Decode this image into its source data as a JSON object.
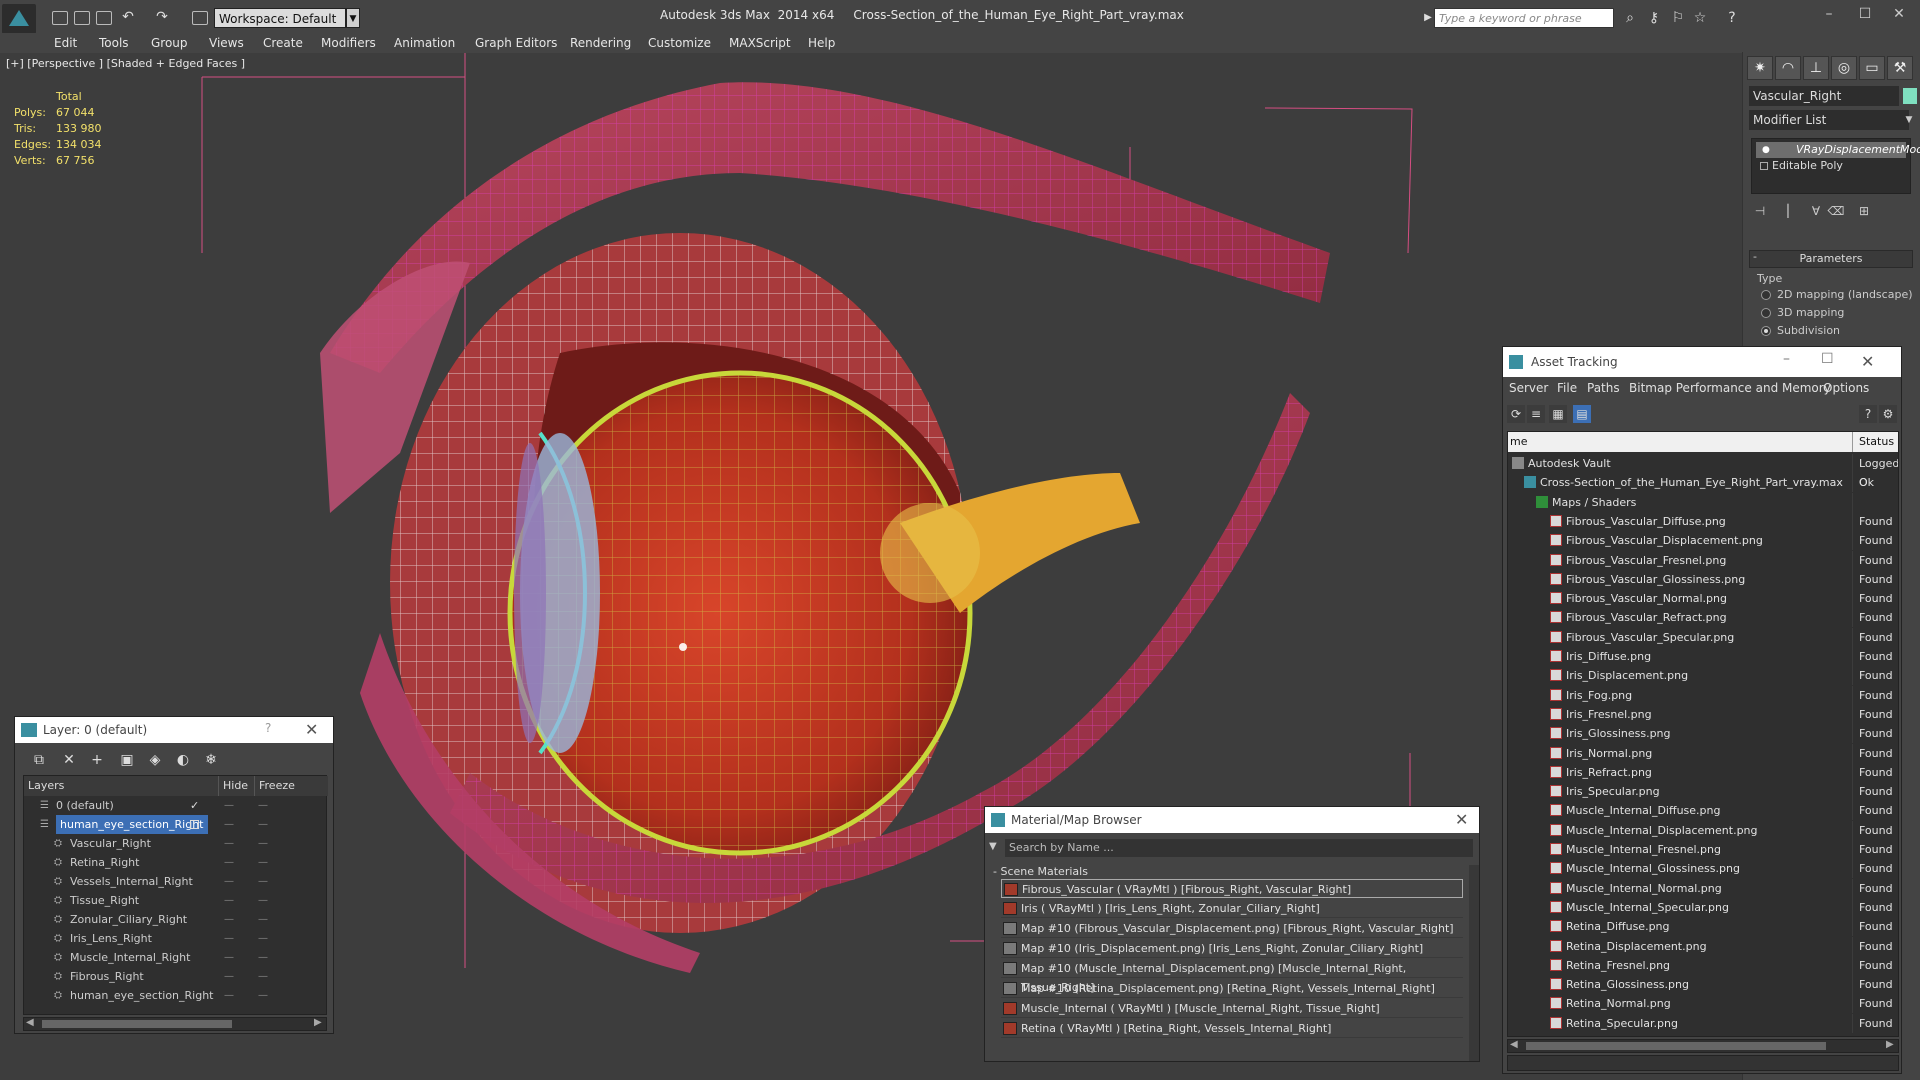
{
  "titlebar": {
    "app_title": "Autodesk 3ds Max  2014 x64     Cross-Section_of_the_Human_Eye_Right_Part_vray.max",
    "workspace": "Workspace: Default",
    "search_placeholder": "Type a keyword or phrase",
    "minimize": "–",
    "maximize": "☐",
    "close": "✕"
  },
  "menubar": [
    "Edit",
    "Tools",
    "Group",
    "Views",
    "Create",
    "Modifiers",
    "Animation",
    "Graph Editors",
    "Rendering",
    "Customize",
    "MAXScript",
    "Help"
  ],
  "viewport": {
    "label": "[+] [Perspective ] [Shaded + Edged Faces ]",
    "stats": {
      "header": "Total",
      "rows": [
        {
          "label": "Polys:",
          "value": "67 044"
        },
        {
          "label": "Tris:",
          "value": "133 980"
        },
        {
          "label": "Edges:",
          "value": "134 034"
        },
        {
          "label": "Verts:",
          "value": "67 756"
        }
      ]
    }
  },
  "command_panel": {
    "object_name": "Vascular_Right",
    "object_color": "#7fe0c0",
    "modifier_list": "Modifier List",
    "stack": [
      "VRayDisplacementMod",
      "Editable Poly"
    ],
    "parameters_header": "Parameters",
    "type_label": "Type",
    "type_options": [
      "2D mapping (landscape)",
      "3D mapping",
      "Subdivision"
    ],
    "selected_type": "Subdivision"
  },
  "layer_dialog": {
    "title": "Layer: 0 (default)",
    "help": "?",
    "columns": {
      "layers": "Layers",
      "hide": "Hide",
      "freeze": "Freeze"
    },
    "rows": [
      {
        "name": "0 (default)",
        "level": 0,
        "checked": true
      },
      {
        "name": "human_eye_section_Right",
        "level": 0,
        "selected": true
      },
      {
        "name": "Vascular_Right",
        "level": 1
      },
      {
        "name": "Retina_Right",
        "level": 1
      },
      {
        "name": "Vessels_Internal_Right",
        "level": 1
      },
      {
        "name": "Tissue_Right",
        "level": 1
      },
      {
        "name": "Zonular_Ciliary_Right",
        "level": 1
      },
      {
        "name": "Iris_Lens_Right",
        "level": 1
      },
      {
        "name": "Muscle_Internal_Right",
        "level": 1
      },
      {
        "name": "Fibrous_Right",
        "level": 1
      },
      {
        "name": "human_eye_section_Right",
        "level": 1
      }
    ]
  },
  "material_browser": {
    "title": "Material/Map Browser",
    "search_placeholder": "Search by Name ...",
    "group": "Scene Materials",
    "rows": [
      {
        "text": "Fibrous_Vascular  ( VRayMtl ) [Fibrous_Right, Vascular_Right]",
        "kind": "vray",
        "selected": true
      },
      {
        "text": "Iris  ( VRayMtl ) [Iris_Lens_Right, Zonular_Ciliary_Right]",
        "kind": "vray"
      },
      {
        "text": "Map #10 (Fibrous_Vascular_Displacement.png) [Fibrous_Right, Vascular_Right]",
        "kind": "map"
      },
      {
        "text": "Map #10 (Iris_Displacement.png) [Iris_Lens_Right, Zonular_Ciliary_Right]",
        "kind": "map"
      },
      {
        "text": "Map #10 (Muscle_Internal_Displacement.png) [Muscle_Internal_Right, Tissue_Right]",
        "kind": "map"
      },
      {
        "text": "Map #10 (Retina_Displacement.png) [Retina_Right, Vessels_Internal_Right]",
        "kind": "map"
      },
      {
        "text": "Muscle_Internal  ( VRayMtl ) [Muscle_Internal_Right, Tissue_Right]",
        "kind": "vray"
      },
      {
        "text": "Retina  ( VRayMtl ) [Retina_Right, Vessels_Internal_Right]",
        "kind": "vray"
      }
    ]
  },
  "asset_tracking": {
    "title": "Asset Tracking",
    "menu": [
      "Server",
      "File",
      "Paths",
      "Bitmap Performance and Memory",
      "Options"
    ],
    "columns": {
      "name": "me",
      "status": "Status"
    },
    "rows": [
      {
        "name": "Autodesk Vault",
        "status": "Logged O",
        "level": 0,
        "icon": "vault"
      },
      {
        "name": "Cross-Section_of_the_Human_Eye_Right_Part_vray.max",
        "status": "Ok",
        "level": 1,
        "icon": "max"
      },
      {
        "name": "Maps / Shaders",
        "status": "",
        "level": 2,
        "icon": "folder"
      },
      {
        "name": "Fibrous_Vascular_Diffuse.png",
        "status": "Found",
        "level": 3,
        "icon": "png"
      },
      {
        "name": "Fibrous_Vascular_Displacement.png",
        "status": "Found",
        "level": 3,
        "icon": "png"
      },
      {
        "name": "Fibrous_Vascular_Fresnel.png",
        "status": "Found",
        "level": 3,
        "icon": "png"
      },
      {
        "name": "Fibrous_Vascular_Glossiness.png",
        "status": "Found",
        "level": 3,
        "icon": "png"
      },
      {
        "name": "Fibrous_Vascular_Normal.png",
        "status": "Found",
        "level": 3,
        "icon": "png"
      },
      {
        "name": "Fibrous_Vascular_Refract.png",
        "status": "Found",
        "level": 3,
        "icon": "png"
      },
      {
        "name": "Fibrous_Vascular_Specular.png",
        "status": "Found",
        "level": 3,
        "icon": "png"
      },
      {
        "name": "Iris_Diffuse.png",
        "status": "Found",
        "level": 3,
        "icon": "png"
      },
      {
        "name": "Iris_Displacement.png",
        "status": "Found",
        "level": 3,
        "icon": "png"
      },
      {
        "name": "Iris_Fog.png",
        "status": "Found",
        "level": 3,
        "icon": "png"
      },
      {
        "name": "Iris_Fresnel.png",
        "status": "Found",
        "level": 3,
        "icon": "png"
      },
      {
        "name": "Iris_Glossiness.png",
        "status": "Found",
        "level": 3,
        "icon": "png"
      },
      {
        "name": "Iris_Normal.png",
        "status": "Found",
        "level": 3,
        "icon": "png"
      },
      {
        "name": "Iris_Refract.png",
        "status": "Found",
        "level": 3,
        "icon": "png"
      },
      {
        "name": "Iris_Specular.png",
        "status": "Found",
        "level": 3,
        "icon": "png"
      },
      {
        "name": "Muscle_Internal_Diffuse.png",
        "status": "Found",
        "level": 3,
        "icon": "png"
      },
      {
        "name": "Muscle_Internal_Displacement.png",
        "status": "Found",
        "level": 3,
        "icon": "png"
      },
      {
        "name": "Muscle_Internal_Fresnel.png",
        "status": "Found",
        "level": 3,
        "icon": "png"
      },
      {
        "name": "Muscle_Internal_Glossiness.png",
        "status": "Found",
        "level": 3,
        "icon": "png"
      },
      {
        "name": "Muscle_Internal_Normal.png",
        "status": "Found",
        "level": 3,
        "icon": "png"
      },
      {
        "name": "Muscle_Internal_Specular.png",
        "status": "Found",
        "level": 3,
        "icon": "png"
      },
      {
        "name": "Retina_Diffuse.png",
        "status": "Found",
        "level": 3,
        "icon": "png"
      },
      {
        "name": "Retina_Displacement.png",
        "status": "Found",
        "level": 3,
        "icon": "png"
      },
      {
        "name": "Retina_Fresnel.png",
        "status": "Found",
        "level": 3,
        "icon": "png"
      },
      {
        "name": "Retina_Glossiness.png",
        "status": "Found",
        "level": 3,
        "icon": "png"
      },
      {
        "name": "Retina_Normal.png",
        "status": "Found",
        "level": 3,
        "icon": "png"
      },
      {
        "name": "Retina_Specular.png",
        "status": "Found",
        "level": 3,
        "icon": "png"
      }
    ]
  }
}
